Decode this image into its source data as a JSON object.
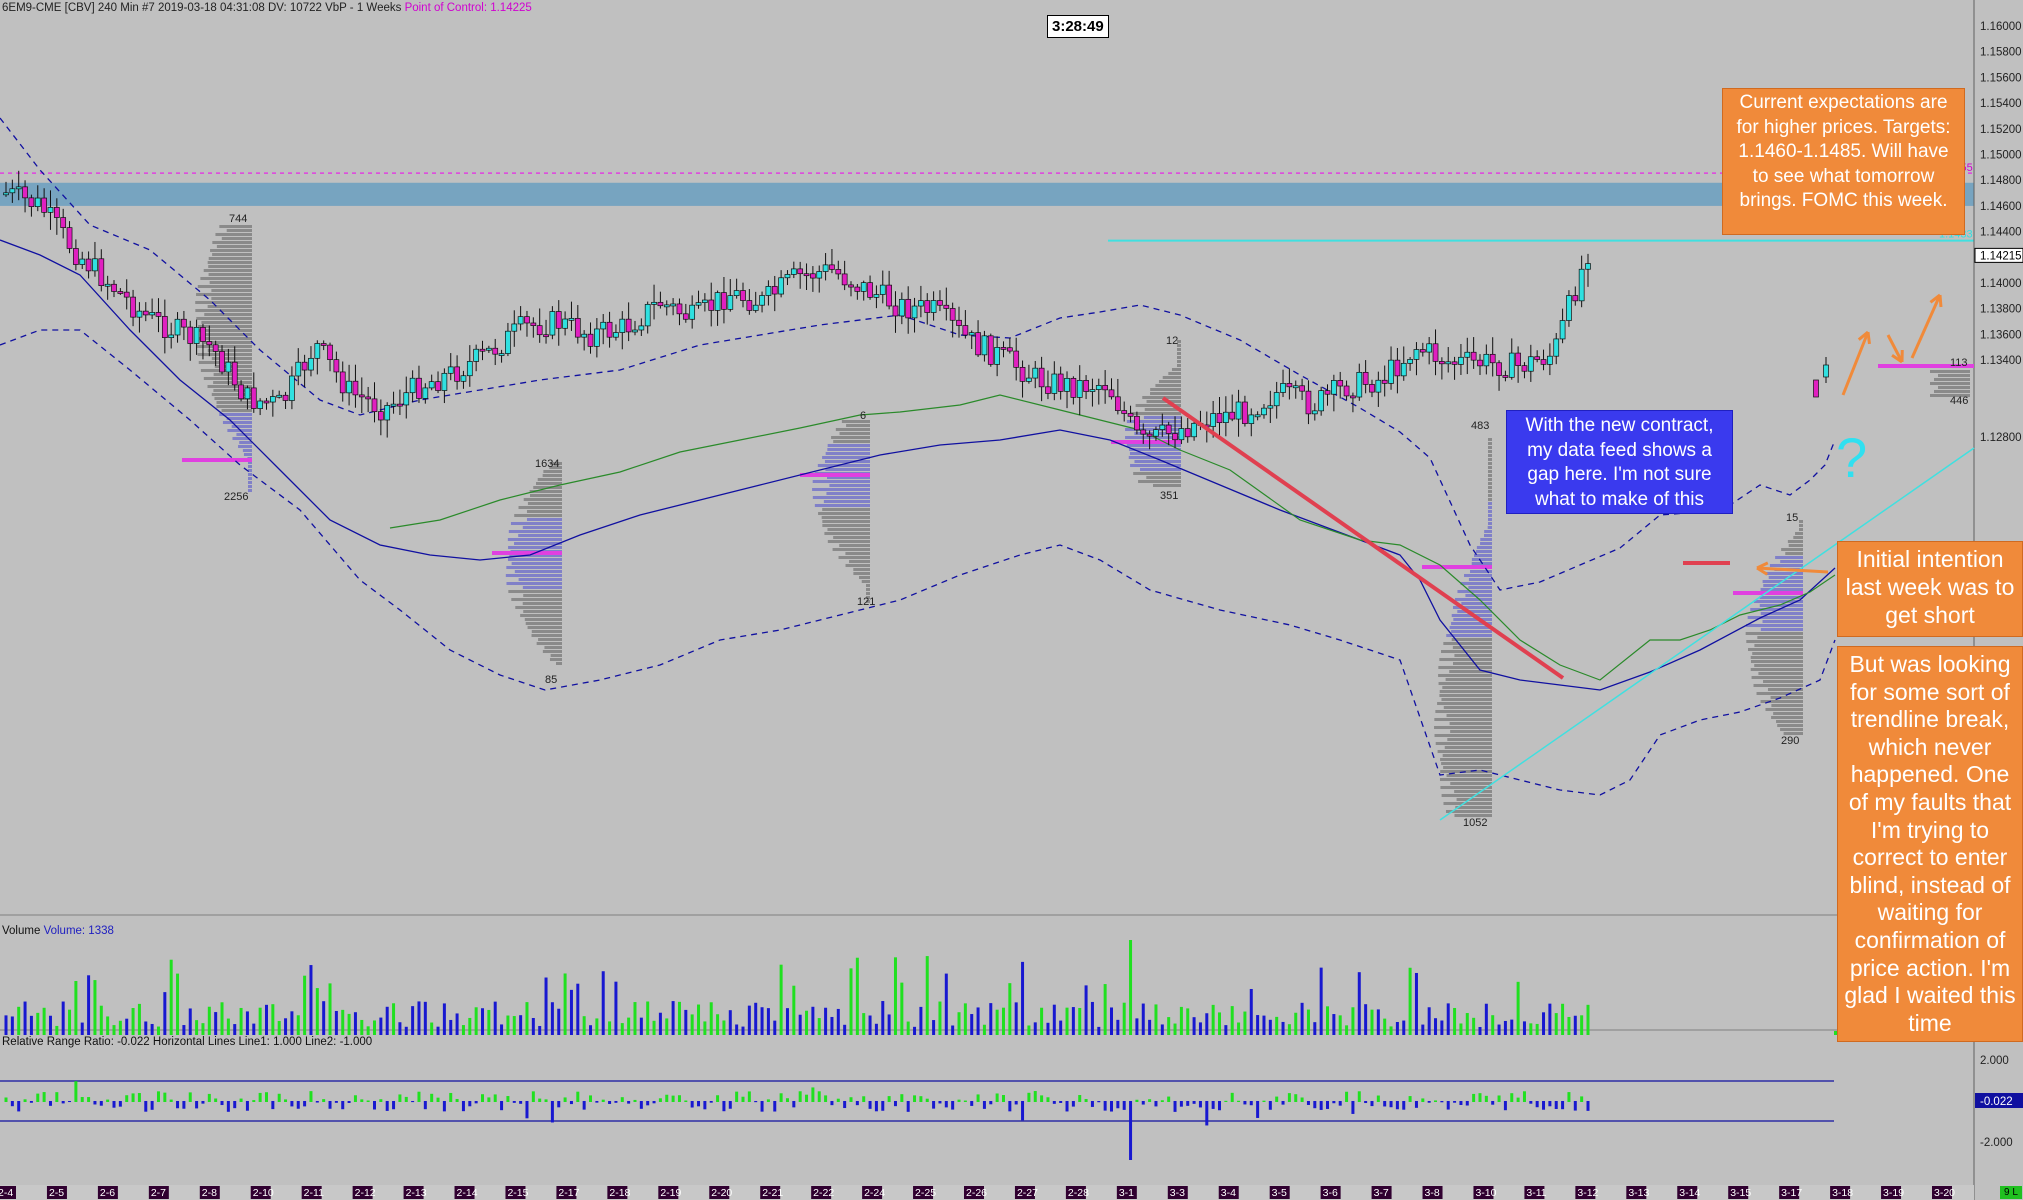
{
  "header": {
    "symbol": "6EM9-CME [CBV]",
    "interval": "240 Min",
    "info": "#7 2019-03-18 04:31:08 DV: 10722 VbP - 1 Weeks",
    "poc_label": "Point of Control: 1.14225"
  },
  "clock": "3:28:49",
  "price_axis": {
    "labels": [
      "1.16000",
      "1.15800",
      "1.15600",
      "1.15400",
      "1.15200",
      "1.15000",
      "1.14800",
      "1.14600",
      "1.14400",
      "1.14000",
      "1.13800",
      "1.13600",
      "1.13400",
      "1.12800"
    ],
    "current_price": "1.14215",
    "poc_tag": "1.14855",
    "cyan_tag": "1.1433"
  },
  "volume_panel": {
    "label": "Volume",
    "value_text": "Volume: 1338"
  },
  "range_panel": {
    "label": "Relative Range",
    "info": "Ratio: -0.022  Horizontal Lines  Line1: 1.000  Line2: -1.000",
    "axis_labels": [
      "2.000",
      "-2.000"
    ],
    "current_value": "-0.022"
  },
  "profile_labels": [
    "744",
    "2256",
    "1634",
    "85",
    "6",
    "121",
    "12",
    "351",
    "483",
    "1052",
    "15",
    "290",
    "113",
    "446"
  ],
  "date_labels": [
    "2-4",
    "2-5",
    "2-6",
    "2-7",
    "2-8",
    "2-10",
    "2-11",
    "2-12",
    "2-13",
    "2-14",
    "2-15",
    "2-17",
    "2-18",
    "2-19",
    "2-20",
    "2-21",
    "2-22",
    "2-24",
    "2-25",
    "2-26",
    "2-27",
    "2-28",
    "3-1",
    "3-3",
    "3-4",
    "3-5",
    "3-6",
    "3-7",
    "3-8",
    "3-10",
    "3-11",
    "3-12",
    "3-13",
    "3-14",
    "3-15",
    "3-17",
    "3-18",
    "3-19",
    "3-20"
  ],
  "corner_badge": "9 L",
  "annotations": {
    "expectations": "Current expectations are for higher prices. Targets: 1.1460-1.1485. Will have to see what tomorrow brings. FOMC this week.",
    "data_feed": "With the new contract, my data feed shows a gap here. I'm not sure what to make of this",
    "initial_intention": "Initial intention last week was to get short",
    "trendline": "But was looking for some sort of trendline break, which never happened. One of my faults that I'm trying to correct to enter blind, instead of waiting for confirmation of price action. I'm glad I waited this time",
    "question_mark": "?"
  },
  "colors": {
    "background": "#c0c0c0",
    "bull_candle": "#30e0e0",
    "bear_candle": "#e020c0",
    "bear_big": "#d01818",
    "vol_up": "#20e020",
    "vol_down": "#1818d0",
    "poc_line": "#e040e0",
    "zone": "#6a9fc0",
    "band": "#1010a0",
    "callout_orange": "#f08a3a",
    "callout_blue": "#3a3aee",
    "trendline_red": "#e04050",
    "trendline_cyan": "#40e0e0"
  },
  "chart_data": {
    "type": "candlestick",
    "title": "6EM9-CME [CBV] 240 Min",
    "ylim": [
      1.124,
      1.1615
    ],
    "price_axis_ticks": [
      1.16,
      1.158,
      1.156,
      1.154,
      1.152,
      1.15,
      1.148,
      1.146,
      1.144,
      1.14,
      1.138,
      1.136,
      1.134,
      1.128
    ],
    "point_of_control": 1.14225,
    "poc_level": 1.14855,
    "resistance_zone": [
      1.146,
      1.1478
    ],
    "current_price": 1.14215,
    "cyan_level": 1.1433,
    "candles_close_approx": [
      1.147,
      1.146,
      1.1425,
      1.14,
      1.1375,
      1.1362,
      1.135,
      1.131,
      1.1305,
      1.1352,
      1.1315,
      1.1302,
      1.132,
      1.133,
      1.1345,
      1.1365,
      1.137,
      1.136,
      1.1365,
      1.1385,
      1.1372,
      1.1392,
      1.1385,
      1.1405,
      1.141,
      1.1395,
      1.1382,
      1.1378,
      1.1355,
      1.1342,
      1.1325,
      1.132,
      1.1322,
      1.1275,
      1.1285,
      1.1295,
      1.13,
      1.1315,
      1.1305,
      1.132,
      1.1325,
      1.135,
      1.1338,
      1.1338,
      1.1335,
      1.1345,
      1.1425
    ],
    "volume": {
      "last": 1338
    },
    "relative_range": {
      "ratio": -0.022,
      "line1": 1.0,
      "line2": -1.0
    }
  }
}
